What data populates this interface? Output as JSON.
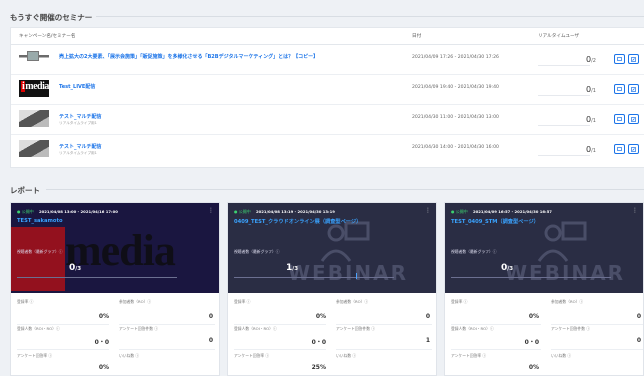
{
  "seminars": {
    "title": "もうすぐ開催のセミナー",
    "headers": {
      "campaign": "キャンペーン名/セミナー名",
      "datetime": "日付",
      "live_users": "リアルタイムユーザ"
    },
    "rows": [
      {
        "title": "売上拡大の2大要素、「展示会施策」「販促施策」を多様化させる「B2Bデジタルマーケティング」とは？【コピー】",
        "sub": "",
        "date": "2021/04/09 17:26 - 2021/04/30 17:26",
        "count": "0",
        "total": "/2",
        "thumb": "t1"
      },
      {
        "title": "Test_LIVE配信",
        "sub": "",
        "date": "2021/04/09 19:40 - 2021/04/30 19:40",
        "count": "0",
        "total": "/1",
        "thumb": "t2"
      },
      {
        "title": "テスト_マルチ配信",
        "sub": "リアルタイムライブ用1",
        "date": "2021/04/30 11:00 - 2021/04/30 13:00",
        "count": "0",
        "total": "/1",
        "thumb": "t3"
      },
      {
        "title": "テスト_マルチ配信",
        "sub": "リアルタイムライブ用1",
        "date": "2021/04/30 14:00 - 2021/04/30 16:00",
        "count": "0",
        "total": "/1",
        "thumb": "t3"
      }
    ]
  },
  "reports": {
    "title": "レポート",
    "cards": [
      {
        "status": "● 公開中",
        "date": "2021/04/08 13:00 - 2021/04/16 17:00",
        "title": "TEST_sakamoto",
        "viewer_label": "視聴者数（最新グラフ）ⓘ",
        "count": "0",
        "total": "/3",
        "hero": "hero1",
        "stats": {
          "r1l": "登録率 ⓘ",
          "r1v": "0%",
          "r1r": "参加者数（RO）ⓘ",
          "r1rv": "0",
          "r2l": "登録人数（ROI・RO）ⓘ",
          "r2v": "0・0",
          "r2r": "アンケート回答件数 ⓘ",
          "r2rv": "0",
          "r3l": "アンケート回答率 ⓘ",
          "r3v": "0%",
          "r3r": "いいね数 ⓘ",
          "r3rv": ""
        }
      },
      {
        "status": "● 公開中",
        "date": "2021/04/08 13:19 - 2021/04/30 13:19",
        "title": "0409_TEST_クラウドオンライン展（調査型ページ）",
        "viewer_label": "視聴者数（最新グラフ）ⓘ",
        "count": "1",
        "total": "/3",
        "hero": "hero2",
        "stats": {
          "r1l": "登録率 ⓘ",
          "r1v": "0%",
          "r1r": "参加者数（RO）ⓘ",
          "r1rv": "0",
          "r2l": "登録人数（ROI・RO）ⓘ",
          "r2v": "0・0",
          "r2r": "アンケート回答件数 ⓘ",
          "r2rv": "1",
          "r3l": "アンケート回答率 ⓘ",
          "r3v": "25%",
          "r3r": "いいね数 ⓘ",
          "r3rv": ""
        }
      },
      {
        "status": "● 公開中",
        "date": "2021/04/09 16:57 - 2021/04/30 16:57",
        "title": "TEST_0409_STM（調査型ページ）",
        "viewer_label": "視聴者数（最新グラフ）ⓘ",
        "count": "0",
        "total": "/3",
        "hero": "hero3",
        "stats": {
          "r1l": "登録率 ⓘ",
          "r1v": "0%",
          "r1r": "参加者数（RO）ⓘ",
          "r1rv": "0",
          "r2l": "登録人数（ROI・RO）ⓘ",
          "r2v": "0・0",
          "r2r": "アンケート回答件数 ⓘ",
          "r2rv": "0",
          "r3l": "アンケート回答率 ⓘ",
          "r3v": "0%",
          "r3r": "いいね数 ⓘ",
          "r3rv": ""
        }
      }
    ]
  },
  "thumb_text": {
    "media": "media",
    "big_media": "media",
    "webinar": "WEBINAR"
  },
  "colors": {
    "link": "#1a73e8",
    "live_green": "#3cd070",
    "hero_dark": "#2a2d44"
  }
}
